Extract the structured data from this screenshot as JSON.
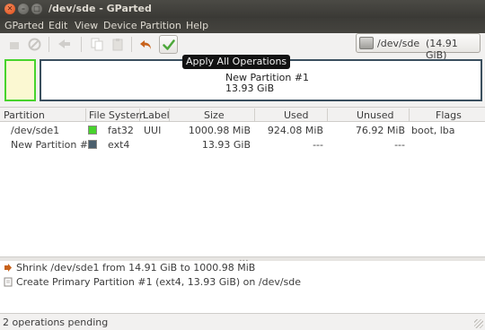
{
  "window": {
    "title": "/dev/sde - GParted",
    "close_glyph": "✕",
    "min_glyph": "–",
    "max_glyph": "□"
  },
  "menu": [
    "GParted",
    "Edit",
    "View",
    "Device",
    "Partition",
    "Help"
  ],
  "toolbar": {
    "icons": [
      "new-partition-icon",
      "delete-icon",
      "resize-move-icon",
      "copy-icon",
      "paste-icon",
      "undo-icon",
      "apply-icon"
    ],
    "tooltip": "Apply All Operations"
  },
  "device": {
    "name": "/dev/sde",
    "size": "(14.91 GiB)"
  },
  "diskmap": {
    "selected_label": "New Partition #1",
    "selected_size": "13.93 GiB",
    "colors": {
      "fat32": "#47d32c",
      "ext4": "#3a4f5e"
    }
  },
  "table": {
    "headers": [
      "Partition",
      "File System",
      "Label",
      "Size",
      "Used",
      "Unused",
      "Flags"
    ],
    "rows": [
      {
        "partition": "/dev/sde1",
        "fs": "fat32",
        "fs_color": "#47d32c",
        "label": "UUI",
        "size": "1000.98 MiB",
        "used": "924.08 MiB",
        "unused": "76.92 MiB",
        "flags": "boot, lba"
      },
      {
        "partition": "New Partition #1",
        "fs": "ext4",
        "fs_color": "#4b5f6d",
        "label": "",
        "size": "13.93 GiB",
        "used": "---",
        "unused": "---",
        "flags": ""
      }
    ]
  },
  "operations": [
    {
      "icon": "shrink-icon",
      "text": "Shrink /dev/sde1 from 14.91 GiB to 1000.98 MiB"
    },
    {
      "icon": "create-partition-icon",
      "text": "Create Primary Partition #1 (ext4, 13.93 GiB) on /dev/sde"
    }
  ],
  "status": "2 operations pending"
}
